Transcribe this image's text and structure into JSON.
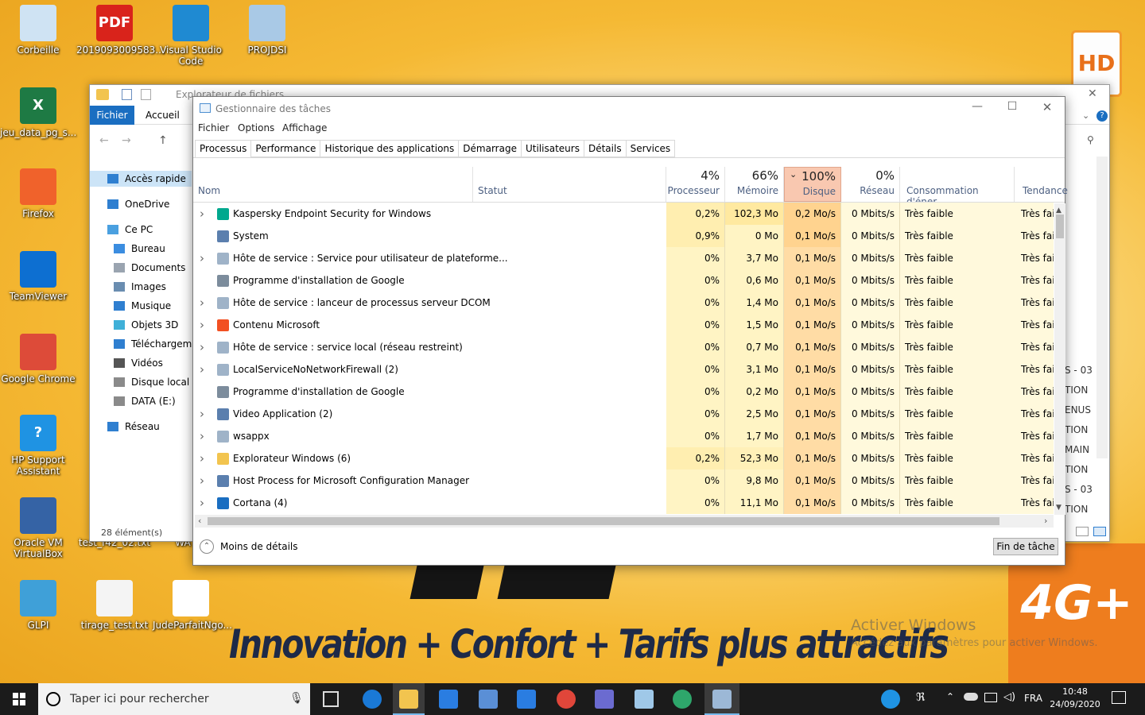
{
  "desktop": {
    "icons": [
      {
        "label": "Corbeille",
        "color": "#cfe3f3",
        "glyph": "recycle-bin-icon"
      },
      {
        "label": "2019093009583...",
        "color": "#d9231b",
        "glyph": "pdf-icon",
        "text": "PDF"
      },
      {
        "label": "Visual Studio Code",
        "color": "#1f8ad2",
        "glyph": "vscode-icon"
      },
      {
        "label": "PROJDSI",
        "color": "#a9c9e6",
        "glyph": "folder-icon"
      },
      {
        "label": "jeu_data_pg_s...",
        "color": "#1e7a44",
        "glyph": "excel-icon",
        "text": "X"
      },
      {
        "label": "Firefox",
        "color": "#f0622b",
        "glyph": "firefox-icon"
      },
      {
        "label": "TeamViewer",
        "color": "#0d6fd1",
        "glyph": "teamviewer-icon"
      },
      {
        "label": "Google Chrome",
        "color": "#dd4b39",
        "glyph": "chrome-icon"
      },
      {
        "label": "HP Support Assistant",
        "color": "#1f93e3",
        "glyph": "hp-support-icon",
        "text": "?"
      },
      {
        "label": "Oracle VM VirtualBox",
        "color": "#3563a5",
        "glyph": "virtualbox-icon"
      },
      {
        "label": "GLPI",
        "color": "#3fa0d8",
        "glyph": "glpi-icon"
      },
      {
        "label": "tirage_test.txt",
        "color": "#f4f4f4",
        "glyph": "text-file-icon"
      },
      {
        "label": "JudeParfaitNgo...",
        "color": "#ffffff",
        "glyph": "file-icon"
      },
      {
        "label": "test_f42_02.txt",
        "color": "#f4f4f4",
        "glyph": "text-file-icon"
      },
      {
        "label": "WA",
        "color": "#f4f4f4",
        "glyph": "file-icon"
      }
    ],
    "wallpaper_text": "Innovation + Confort + Tarifs plus attractifs",
    "hd_logo": "HD",
    "g4_logo": "4G+",
    "activate_title": "Activer Windows",
    "activate_sub": "Accédez aux paramètres pour activer Windows."
  },
  "explorer": {
    "title": "Explorateur de fichiers",
    "tab_file": "Fichier",
    "tab_home": "Accueil",
    "nav": [
      {
        "label": "Accès rapide",
        "icon": "star-icon",
        "color": "#2f7fd0"
      },
      {
        "label": "OneDrive",
        "icon": "cloud-icon",
        "color": "#2f7fd0"
      },
      {
        "label": "Ce PC",
        "icon": "computer-icon",
        "color": "#4aa0e0"
      },
      {
        "label": "Bureau",
        "icon": "desktop-folder-icon",
        "color": "#3b8de0"
      },
      {
        "label": "Documents",
        "icon": "documents-icon",
        "color": "#9aa4b0"
      },
      {
        "label": "Images",
        "icon": "images-icon",
        "color": "#6a8db0"
      },
      {
        "label": "Musique",
        "icon": "music-icon",
        "color": "#2f7fd0"
      },
      {
        "label": "Objets 3D",
        "icon": "cube-icon",
        "color": "#3fb0d8"
      },
      {
        "label": "Téléchargements",
        "icon": "download-icon",
        "color": "#2f7fd0"
      },
      {
        "label": "Vidéos",
        "icon": "video-icon",
        "color": "#555"
      },
      {
        "label": "Disque local (C:)",
        "icon": "drive-icon",
        "color": "#8a8a8a"
      },
      {
        "label": "DATA (E:)",
        "icon": "drive-icon",
        "color": "#8a8a8a"
      },
      {
        "label": "Réseau",
        "icon": "network-icon",
        "color": "#2f7fd0"
      }
    ],
    "status": "28 élément(s)",
    "right_fragments": [
      "S - 03",
      "TION",
      "ENUS",
      "TION",
      "MAIN",
      "TION",
      "S - 03",
      "TION"
    ]
  },
  "taskmgr": {
    "title": "Gestionnaire des tâches",
    "menu": [
      "Fichier",
      "Options",
      "Affichage"
    ],
    "tabs": [
      "Processus",
      "Performance",
      "Historique des applications",
      "Démarrage",
      "Utilisateurs",
      "Détails",
      "Services"
    ],
    "columns": {
      "name": "Nom",
      "status": "Statut",
      "cpu": {
        "pct": "4%",
        "label": "Processeur"
      },
      "mem": {
        "pct": "66%",
        "label": "Mémoire"
      },
      "disk": {
        "pct": "100%",
        "label": "Disque"
      },
      "net": {
        "pct": "0%",
        "label": "Réseau"
      },
      "power": "Consommation d'éner...",
      "trend": "Tendance"
    },
    "rows": [
      {
        "name": "Kaspersky Endpoint Security for Windows",
        "expand": true,
        "icon": "kaspersky-icon",
        "cpu": "0,2%",
        "mem": "102,3 Mo",
        "disk": "0,2 Mo/s",
        "net": "0 Mbits/s",
        "power": "Très faible",
        "trend": "Très faib"
      },
      {
        "name": "System",
        "expand": false,
        "icon": "system-icon",
        "cpu": "0,9%",
        "mem": "0 Mo",
        "disk": "0,1 Mo/s",
        "net": "0 Mbits/s",
        "power": "Très faible",
        "trend": "Très faib"
      },
      {
        "name": "Hôte de service : Service pour utilisateur de plateforme...",
        "expand": true,
        "icon": "gear-icon",
        "cpu": "0%",
        "mem": "3,7 Mo",
        "disk": "0,1 Mo/s",
        "net": "0 Mbits/s",
        "power": "Très faible",
        "trend": "Très faib"
      },
      {
        "name": "Programme d'installation de Google",
        "expand": false,
        "icon": "installer-icon",
        "cpu": "0%",
        "mem": "0,6 Mo",
        "disk": "0,1 Mo/s",
        "net": "0 Mbits/s",
        "power": "Très faible",
        "trend": "Très faib"
      },
      {
        "name": "Hôte de service : lanceur de processus serveur DCOM",
        "expand": true,
        "icon": "gear-icon",
        "cpu": "0%",
        "mem": "1,4 Mo",
        "disk": "0,1 Mo/s",
        "net": "0 Mbits/s",
        "power": "Très faible",
        "trend": "Très faib"
      },
      {
        "name": "Contenu Microsoft",
        "expand": true,
        "icon": "microsoft-icon",
        "cpu": "0%",
        "mem": "1,5 Mo",
        "disk": "0,1 Mo/s",
        "net": "0 Mbits/s",
        "power": "Très faible",
        "trend": "Très faib"
      },
      {
        "name": "Hôte de service : service local (réseau restreint)",
        "expand": true,
        "icon": "gear-icon",
        "cpu": "0%",
        "mem": "0,7 Mo",
        "disk": "0,1 Mo/s",
        "net": "0 Mbits/s",
        "power": "Très faible",
        "trend": "Très faib"
      },
      {
        "name": "LocalServiceNoNetworkFirewall (2)",
        "expand": true,
        "icon": "gear-icon",
        "cpu": "0%",
        "mem": "3,1 Mo",
        "disk": "0,1 Mo/s",
        "net": "0 Mbits/s",
        "power": "Très faible",
        "trend": "Très faib"
      },
      {
        "name": "Programme d'installation de Google",
        "expand": false,
        "icon": "installer-icon",
        "cpu": "0%",
        "mem": "0,2 Mo",
        "disk": "0,1 Mo/s",
        "net": "0 Mbits/s",
        "power": "Très faible",
        "trend": "Très faib"
      },
      {
        "name": "Video Application (2)",
        "expand": true,
        "icon": "app-icon",
        "cpu": "0%",
        "mem": "2,5 Mo",
        "disk": "0,1 Mo/s",
        "net": "0 Mbits/s",
        "power": "Très faible",
        "trend": "Très faib"
      },
      {
        "name": "wsappx",
        "expand": true,
        "icon": "gear-icon",
        "cpu": "0%",
        "mem": "1,7 Mo",
        "disk": "0,1 Mo/s",
        "net": "0 Mbits/s",
        "power": "Très faible",
        "trend": "Très faib"
      },
      {
        "name": "Explorateur Windows (6)",
        "expand": true,
        "icon": "explorer-folder-icon",
        "cpu": "0,2%",
        "mem": "52,3 Mo",
        "disk": "0,1 Mo/s",
        "net": "0 Mbits/s",
        "power": "Très faible",
        "trend": "Très faib"
      },
      {
        "name": "Host Process for Microsoft Configuration Manager",
        "expand": true,
        "icon": "app-icon",
        "cpu": "0%",
        "mem": "9,8 Mo",
        "disk": "0,1 Mo/s",
        "net": "0 Mbits/s",
        "power": "Très faible",
        "trend": "Très faib"
      },
      {
        "name": "Cortana (4)",
        "expand": true,
        "icon": "cortana-icon",
        "cpu": "0%",
        "mem": "11,1 Mo",
        "disk": "0,1 Mo/s",
        "net": "0 Mbits/s",
        "power": "Très faible",
        "trend": "Très faib"
      }
    ],
    "less_details": "Moins de détails",
    "end_task": "Fin de tâche"
  },
  "taskbar": {
    "search_placeholder": "Taper ici pour rechercher",
    "lang": "FRA",
    "time": "10:48",
    "date": "24/09/2020"
  },
  "colors": {
    "cpu_mem_fill": "#fff4c4",
    "disk_fill": "#ffdca5",
    "disk_hdr": "#f9c8b0",
    "accent": "#1a6ec1"
  }
}
